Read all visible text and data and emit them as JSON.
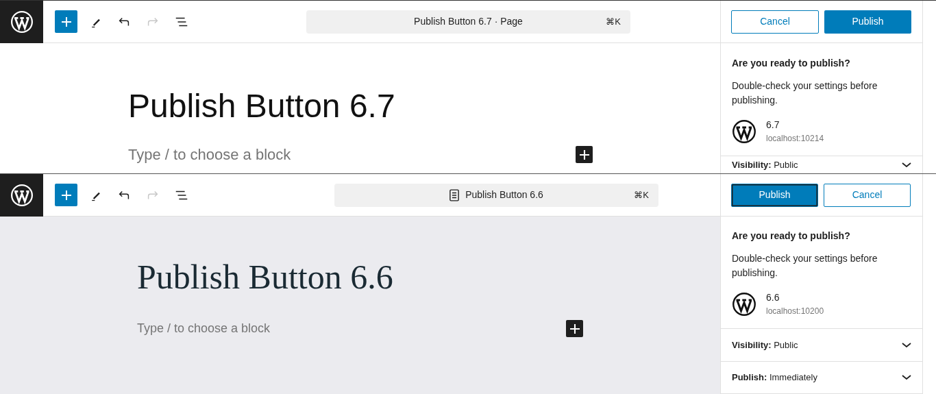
{
  "panels": [
    {
      "kind": "modern",
      "document_title": "Publish Button 6.7 · Page",
      "document_icon": false,
      "shortcut": "⌘K",
      "buttons": [
        {
          "label": "Cancel",
          "kind": "secondary",
          "focused": false
        },
        {
          "label": "Publish",
          "kind": "primary",
          "focused": false
        }
      ],
      "post_title": "Publish Button 6.7",
      "placeholder": "Type / to choose a block",
      "publish_panel": {
        "heading": "Are you ready to publish?",
        "text": "Double-check your settings before publishing.",
        "site_name": "6.7",
        "site_url": "localhost:10214",
        "sections": [
          {
            "label": "Visibility:",
            "value": "Public"
          }
        ]
      }
    },
    {
      "kind": "classic",
      "document_title": "Publish Button 6.6",
      "document_icon": true,
      "shortcut": "⌘K",
      "buttons": [
        {
          "label": "Publish",
          "kind": "primary",
          "focused": true
        },
        {
          "label": "Cancel",
          "kind": "secondary",
          "focused": false
        }
      ],
      "post_title": "Publish Button 6.6",
      "placeholder": "Type / to choose a block",
      "publish_panel": {
        "heading": "Are you ready to publish?",
        "text": "Double-check your settings before publishing.",
        "site_name": "6.6",
        "site_url": "localhost:10200",
        "sections": [
          {
            "label": "Visibility:",
            "value": "Public"
          },
          {
            "label": "Publish:",
            "value": "Immediately"
          }
        ]
      }
    }
  ]
}
